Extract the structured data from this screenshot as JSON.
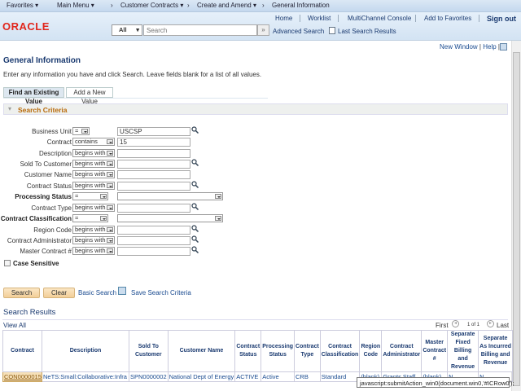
{
  "nav": {
    "favorites": "Favorites",
    "main_menu": "Main Menu",
    "customer_contracts": "Customer Contracts",
    "create_amend": "Create and Amend",
    "current": "General Information"
  },
  "header": {
    "logo": "ORACLE",
    "links": [
      "Home",
      "Worklist",
      "MultiChannel Console",
      "Add to Favorites",
      "Sign out"
    ],
    "search_scope": "All",
    "search_placeholder": "Search",
    "advanced_search": "Advanced Search",
    "last_search_results": "Last Search Results"
  },
  "page": {
    "new_window": "New Window",
    "help": "Help",
    "title": "General Information",
    "instructions": "Enter any information you have and click Search. Leave fields blank for a list of all values.",
    "tabs": [
      "Find an Existing Value",
      "Add a New Value"
    ],
    "section": "Search Criteria"
  },
  "fields": [
    {
      "label": "Business Unit",
      "op": "=",
      "value": "USCSP",
      "lookup": true,
      "bold": false
    },
    {
      "label": "Contract",
      "op": "contains",
      "value": "15",
      "lookup": false
    },
    {
      "label": "Description",
      "op": "begins with",
      "value": "",
      "lookup": false
    },
    {
      "label": "Sold To Customer",
      "op": "begins with",
      "value": "",
      "lookup": true
    },
    {
      "label": "Customer Name",
      "op": "begins with",
      "value": "",
      "lookup": false
    },
    {
      "label": "Contract Status",
      "op": "begins with",
      "value": "",
      "lookup": true
    },
    {
      "label": "Processing Status",
      "op": "=",
      "value": "",
      "dropdown": true,
      "bold": true
    },
    {
      "label": "Contract Type",
      "op": "begins with",
      "value": "",
      "lookup": true
    },
    {
      "label": "Contract Classification",
      "op": "=",
      "value": "",
      "dropdown": true,
      "bold": true
    },
    {
      "label": "Region Code",
      "op": "begins with",
      "value": "",
      "lookup": true
    },
    {
      "label": "Contract Administrator",
      "op": "begins with",
      "value": "",
      "lookup": true
    },
    {
      "label": "Master Contract #",
      "op": "begins with",
      "value": "",
      "lookup": true
    }
  ],
  "case_sensitive": {
    "label": "Case Sensitive",
    "checked": false
  },
  "actions": {
    "search": "Search",
    "clear": "Clear",
    "basic_search": "Basic Search",
    "save_criteria": "Save Search Criteria"
  },
  "results": {
    "title": "Search Results",
    "view_all": "View All",
    "first": "First",
    "pager": "1 of 1",
    "last": "Last",
    "columns": [
      "Contract",
      "Description",
      "Sold To Customer",
      "Customer Name",
      "Contract Status",
      "Processing Status",
      "Contract Type",
      "Contract Classification",
      "Region Code",
      "Contract Administrator",
      "Master Contract #",
      "Separate Fixed Billing and Revenue",
      "Separate As Incurred Billing and Revenue"
    ],
    "rows": [
      [
        "CON0000015",
        "NeTS:Small:Collaborative:Infra",
        "SPN0000002",
        "National Dept of Energy",
        "ACTIVE",
        "Active",
        "CRB",
        "Standard",
        "(blank)",
        "Grants Staff",
        "(blank)",
        "N",
        "N"
      ]
    ]
  },
  "tooltip": "javascript:submitAction_win0(document.win0,'#ICRow0');"
}
